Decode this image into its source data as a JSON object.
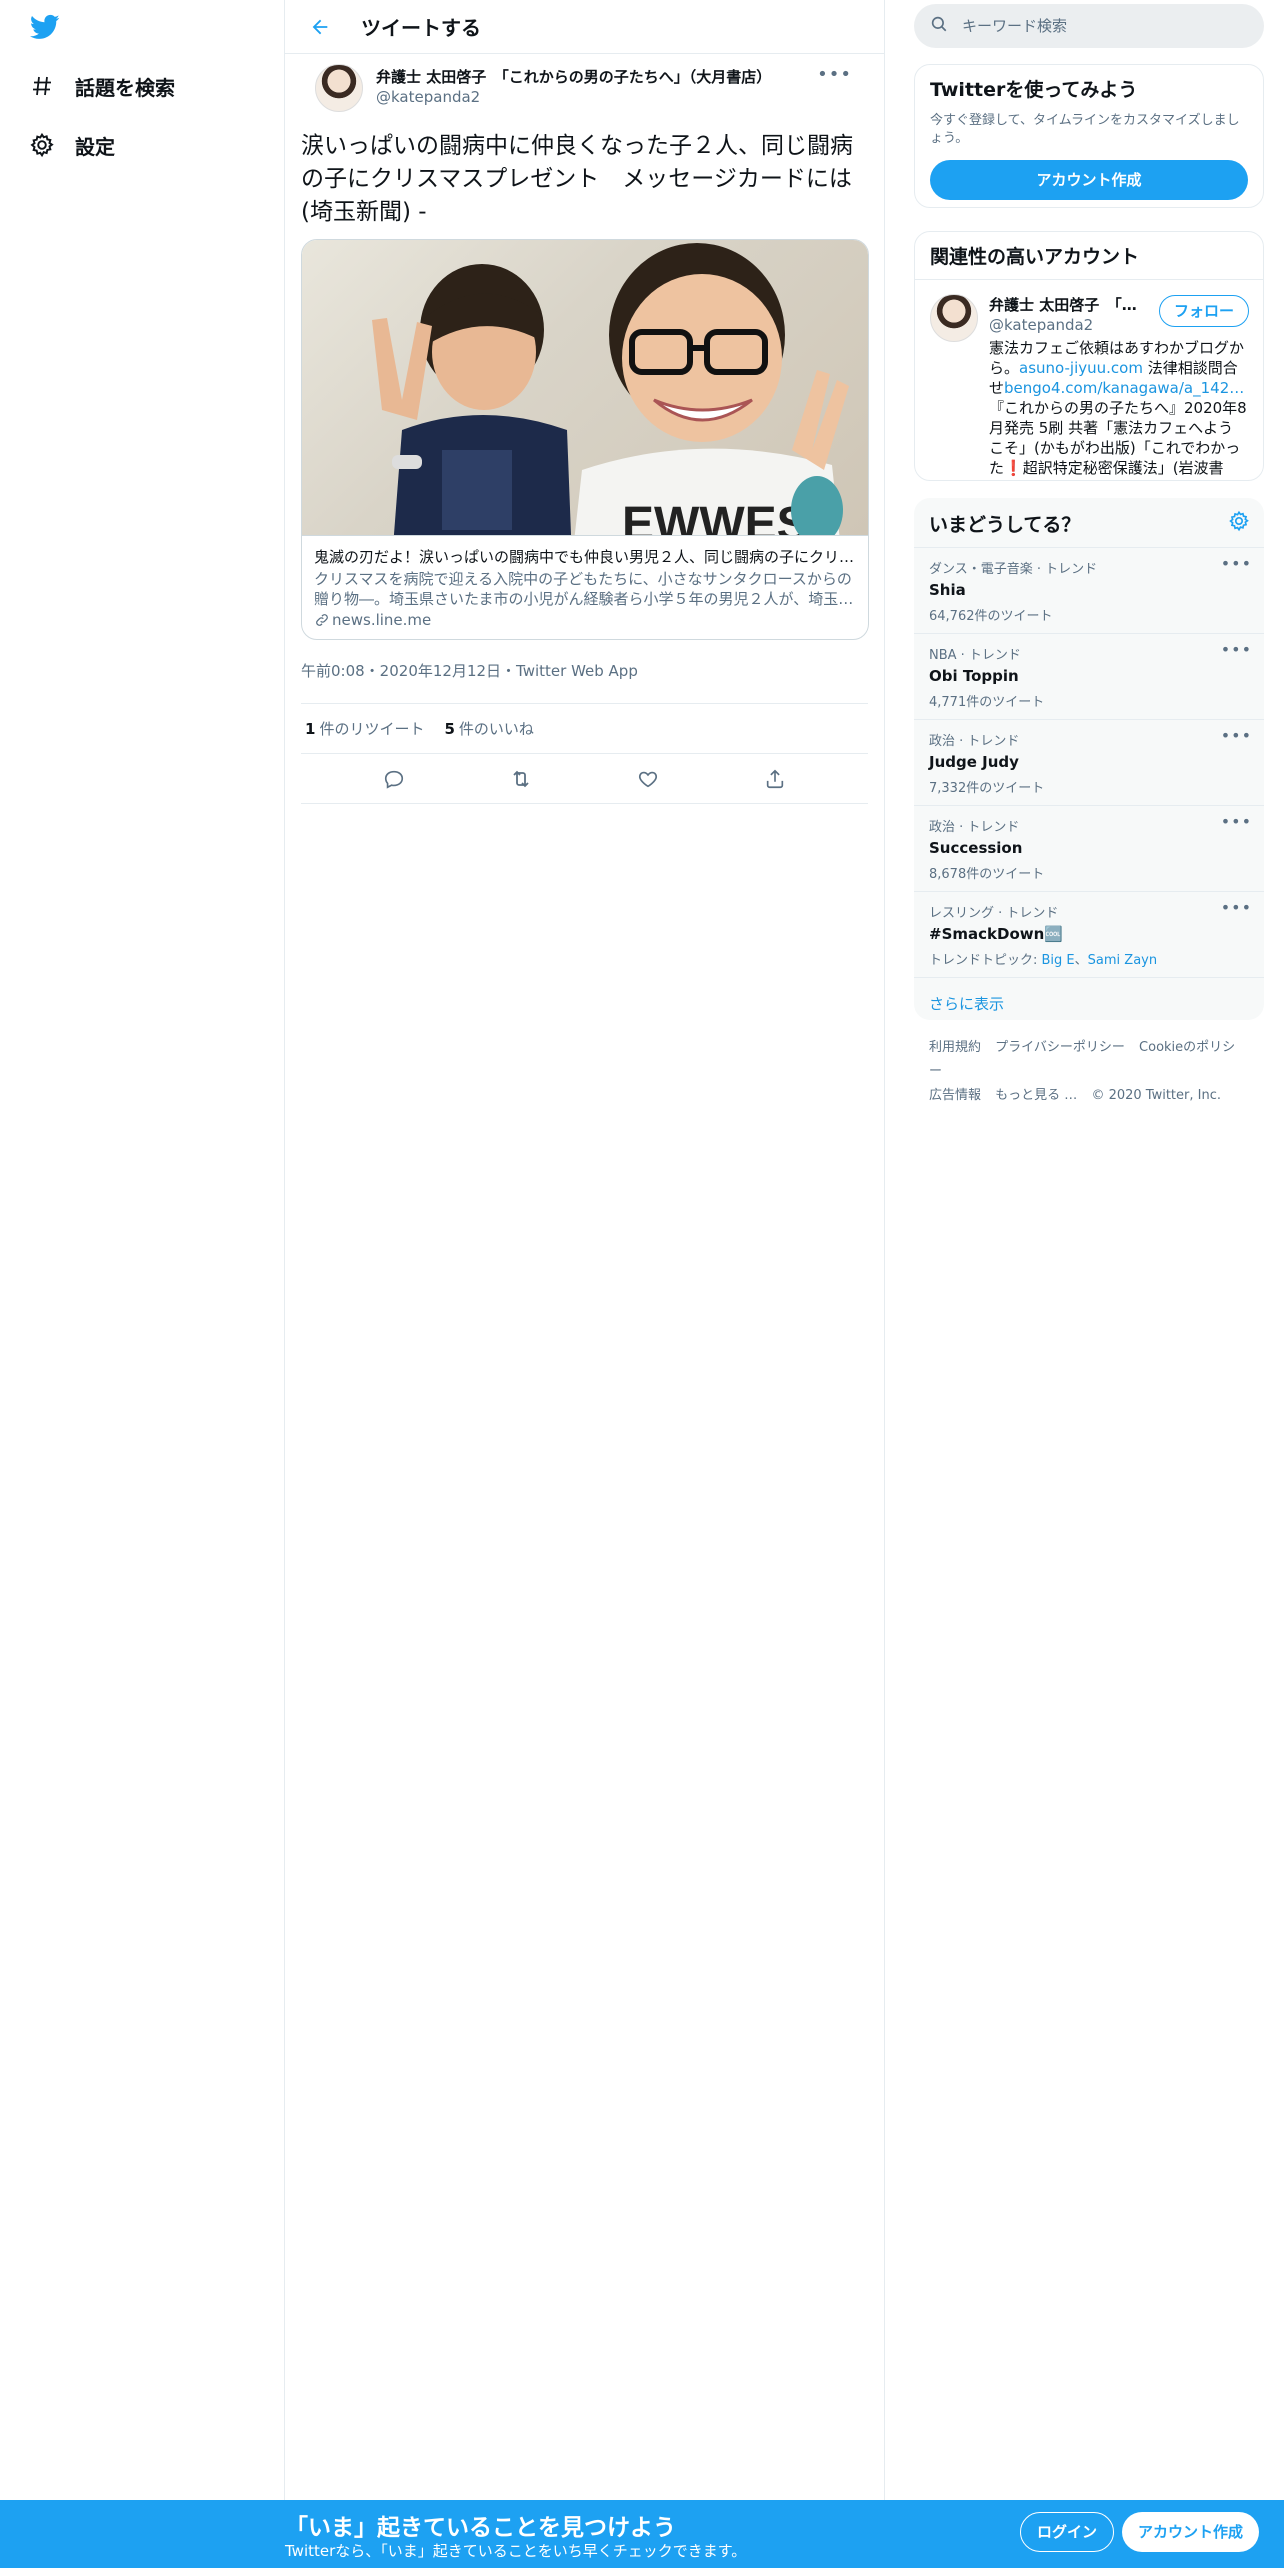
{
  "nav": {
    "items": [
      {
        "label": "話題を検索",
        "icon": "hashtag-icon"
      },
      {
        "label": "設定",
        "icon": "gear-icon"
      }
    ]
  },
  "header": {
    "title": "ツイートする"
  },
  "tweet": {
    "author_name": "弁護士 太田啓子　「これからの男の子たちへ」（大月書店）",
    "author_handle": "@katepanda2",
    "text": "涙いっぱいの闘病中に仲良くなった子２人、同じ闘病の子にクリスマスプレゼント　メッセージカードには (埼玉新聞) -",
    "card": {
      "title": "鬼滅の刃だよ！涙いっぱいの闘病中でも仲良い男児２人、同じ闘病の子にクリ…",
      "description": "クリスマスを病院で迎える入院中の子どもたちに、小さなサンタクロースからの贈り物―。埼玉県さいたま市の小児がん経験者ら小学５年の男児２人が、埼玉…",
      "domain": "news.line.me"
    },
    "meta": "午前0:08・2020年12月12日・Twitter Web App",
    "retweets_count": "1",
    "retweets_label": "件のリツイート",
    "likes_count": "5",
    "likes_label": "件のいいね"
  },
  "right": {
    "search_placeholder": "キーワード検索",
    "signup": {
      "title": "Twitterを使ってみよう",
      "desc": "今すぐ登録して、タイムラインをカスタマイズしましょう。",
      "button": "アカウント作成"
    },
    "related": {
      "title": "関連性の高いアカウント",
      "name": "弁護士 太田啓子　「…",
      "handle": "@katepanda2",
      "follow": "フォロー",
      "bio_1": "憲法カフェご依頼はあすわかブログから。",
      "bio_link1": "asuno-jiyuu.com",
      "bio_2": " 法律相談問合せ",
      "bio_link2": "bengo4.com/kanagawa/a_142…",
      "bio_3": " 『これからの男の子たちへ』2020年8月発売 5刷 共著「憲法カフェへようこそ」(かもがわ出版)「これでわかった",
      "bio_emoji": "❗",
      "bio_4": "超訳特定秘密保護法」(岩波書店)。"
    },
    "trends": {
      "title": "いまどうしてる？",
      "items": [
        {
          "context": "ダンス・電子音楽 · トレンド",
          "name": "Shia",
          "count": "64,762件のツイート"
        },
        {
          "context": "NBA · トレンド",
          "name": "Obi Toppin",
          "count": "4,771件のツイート"
        },
        {
          "context": "政治 · トレンド",
          "name": "Judge Judy",
          "count": "7,332件のツイート"
        },
        {
          "context": "政治 · トレンド",
          "name": "Succession",
          "count": "8,678件のツイート"
        }
      ],
      "last": {
        "context": "レスリング · トレンド",
        "name": "#SmackDown",
        "badge": "🆒",
        "topic_label": "トレンドトピック: ",
        "topic_1": "Big E",
        "topic_sep": "、",
        "topic_2": "Sami Zayn"
      },
      "show_more": "さらに表示"
    },
    "footer": [
      "利用規約",
      "プライバシーポリシー",
      "Cookieのポリシー",
      "広告情報",
      "もっと見る …",
      "© 2020 Twitter, Inc."
    ]
  },
  "bottom": {
    "title": "「いま」起きていることを見つけよう",
    "subtitle": "Twitterなら、「いま」起きていることをいち早くチェックできます。",
    "login": "ログイン",
    "signup": "アカウント作成"
  },
  "colors": {
    "accent": "#1da1f2",
    "link": "#1b95e0",
    "muted": "#5b7083"
  }
}
